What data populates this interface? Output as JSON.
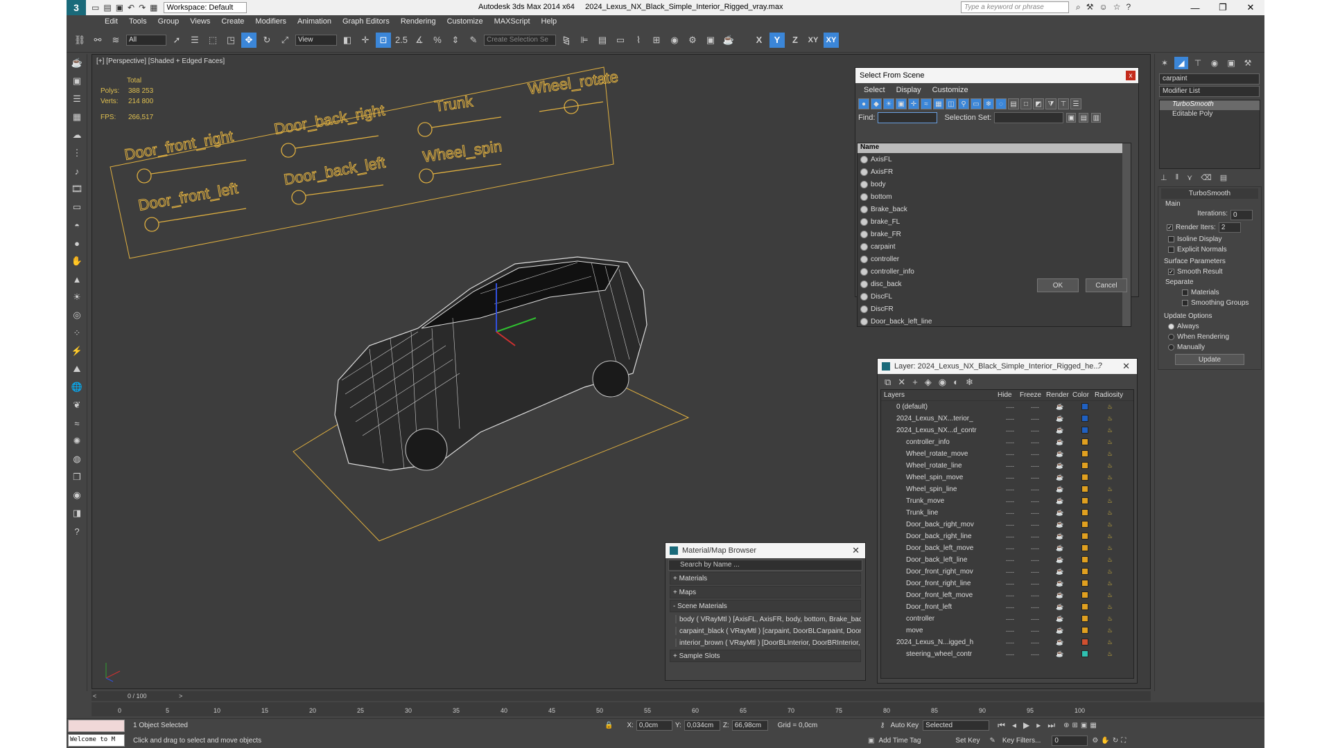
{
  "window": {
    "workspace": "Workspace: Default",
    "app_title": "Autodesk 3ds Max  2014 x64",
    "file_title": "2024_Lexus_NX_Black_Simple_Interior_Rigged_vray.max",
    "search_placeholder": "Type a keyword or phrase",
    "min_label": "—",
    "max_label": "❐",
    "close_label": "✕"
  },
  "menu": [
    "Edit",
    "Tools",
    "Group",
    "Views",
    "Create",
    "Modifiers",
    "Animation",
    "Graph Editors",
    "Rendering",
    "Customize",
    "MAXScript",
    "Help"
  ],
  "toolbar": {
    "filter_value": "All",
    "refcoord_value": "View",
    "selset_placeholder": "Create Selection Se",
    "snap_label": "2.5",
    "axis_labels": [
      "X",
      "Y",
      "Z",
      "XY",
      "XY"
    ]
  },
  "viewport": {
    "label": "[+] [Perspective] [Shaded + Edged Faces]",
    "stats_total": "Total",
    "polys_label": "Polys:",
    "polys_value": "388 253",
    "verts_label": "Verts:",
    "verts_value": "214 800",
    "fps_label": "FPS:",
    "fps_value": "266,517",
    "rig_labels": [
      "Door_front_right",
      "Door_back_right",
      "Trunk",
      "Wheel_rotate",
      "Door_front_left",
      "Door_back_left",
      "Wheel_spin"
    ]
  },
  "select_from_scene": {
    "title": "Select From Scene",
    "menu": [
      "Select",
      "Display",
      "Customize"
    ],
    "find_label": "Find:",
    "selset_label": "Selection Set:",
    "header": "Name",
    "items": [
      "AxisFL",
      "AxisFR",
      "body",
      "bottom",
      "Brake_back",
      "brake_FL",
      "brake_FR",
      "carpaint",
      "controller",
      "controller_info",
      "disc_back",
      "DiscFL",
      "DiscFR",
      "Door_back_left_line"
    ],
    "ok": "OK",
    "cancel": "Cancel",
    "close": "x"
  },
  "layer_dialog": {
    "title": "Layer: 2024_Lexus_NX_Black_Simple_Interior_Rigged_he...",
    "help": "?",
    "close": "✕",
    "columns": [
      "Layers",
      "Hide",
      "Freeze",
      "Render",
      "Color",
      "Radiosity"
    ],
    "rows": [
      {
        "name": "0 (default)",
        "color": "#2060c0"
      },
      {
        "name": "2024_Lexus_NX...terior_",
        "color": "#2060c0"
      },
      {
        "name": "2024_Lexus_NX...d_contr",
        "color": "#2060c0"
      },
      {
        "name": "controller_info",
        "color": "#e0a020"
      },
      {
        "name": "Wheel_rotate_move",
        "color": "#e0a020"
      },
      {
        "name": "Wheel_rotate_line",
        "color": "#e0a020"
      },
      {
        "name": "Wheel_spin_move",
        "color": "#e0a020"
      },
      {
        "name": "Wheel_spin_line",
        "color": "#e0a020"
      },
      {
        "name": "Trunk_move",
        "color": "#e0a020"
      },
      {
        "name": "Trunk_line",
        "color": "#e0a020"
      },
      {
        "name": "Door_back_right_mov",
        "color": "#e0a020"
      },
      {
        "name": "Door_back_right_line",
        "color": "#e0a020"
      },
      {
        "name": "Door_back_left_move",
        "color": "#e0a020"
      },
      {
        "name": "Door_back_left_line",
        "color": "#e0a020"
      },
      {
        "name": "Door_front_right_mov",
        "color": "#e0a020"
      },
      {
        "name": "Door_front_right_line",
        "color": "#e0a020"
      },
      {
        "name": "Door_front_left_move",
        "color": "#e0a020"
      },
      {
        "name": "Door_front_left",
        "color": "#e0a020"
      },
      {
        "name": "controller",
        "color": "#e0a020"
      },
      {
        "name": "move",
        "color": "#e0a020"
      },
      {
        "name": "2024_Lexus_N...igged_h",
        "color": "#d05030"
      },
      {
        "name": "steering_wheel_contr",
        "color": "#30c0b0"
      }
    ]
  },
  "material_browser": {
    "title": "Material/Map Browser",
    "search_placeholder": "Search by Name ...",
    "groups": [
      "+ Materials",
      "+ Maps",
      "- Scene Materials",
      "+ Sample Slots"
    ],
    "scene_materials": [
      "body  ( VRayMtl ) [AxisFL, AxisFR, body, bottom, Brake_back, b...",
      "carpaint_black  ( VRayMtl ) [carpaint, DoorBLCarpaint, DoorBRC...",
      "interior_brown  ( VRayMtl ) [DoorBLInterior, DoorBRInterior, Do..."
    ]
  },
  "command_panel": {
    "object_name": "carpaint",
    "modifier_list": "Modifier List",
    "stack": [
      "TurboSmooth",
      "Editable Poly"
    ],
    "rollout_title": "TurboSmooth",
    "main_label": "Main",
    "iterations_label": "Iterations:",
    "iterations_value": "0",
    "render_iters_label": "Render Iters:",
    "render_iters_value": "2",
    "isoline": "Isoline Display",
    "explicit": "Explicit Normals",
    "surface_params": "Surface Parameters",
    "smooth_result": "Smooth Result",
    "separate": "Separate",
    "materials": "Materials",
    "smoothing_groups": "Smoothing Groups",
    "update_options": "Update Options",
    "always": "Always",
    "when_rendering": "When Rendering",
    "manually": "Manually",
    "update_btn": "Update"
  },
  "timeline": {
    "frame": "0 / 100",
    "ticks": [
      "0",
      "5",
      "10",
      "15",
      "20",
      "25",
      "30",
      "35",
      "40",
      "45",
      "50",
      "55",
      "60",
      "65",
      "70",
      "75",
      "80",
      "85",
      "90",
      "95",
      "100"
    ]
  },
  "status": {
    "maxscript": "Welcome to M",
    "selected": "1 Object Selected",
    "prompt": "Click and drag to select and move objects",
    "x_label": "X:",
    "x_value": "0,0cm",
    "y_label": "Y:",
    "y_value": "0,034cm",
    "z_label": "Z:",
    "z_value": "66,98cm",
    "grid": "Grid = 0,0cm",
    "add_time_tag": "Add Time Tag",
    "auto_key": "Auto Key",
    "set_key": "Set Key",
    "selected_dd": "Selected",
    "key_filters": "Key Filters...",
    "frame_field": "0"
  }
}
